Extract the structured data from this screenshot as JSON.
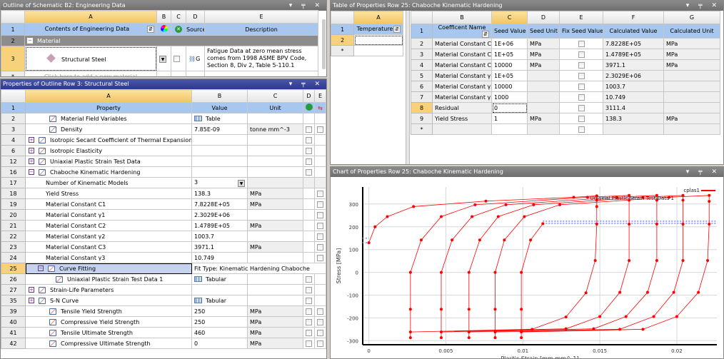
{
  "outline": {
    "title": "Outline of Schematic B2: Engineering Data",
    "columns": [
      "A",
      "B",
      "C",
      "D",
      "E"
    ],
    "header": {
      "contents": "Contents of Engineering Data",
      "source": "Source",
      "description": "Description"
    },
    "category": "Material",
    "material": {
      "name": "Structural Steel",
      "source": "G",
      "description": "Fatigue Data at zero mean stress comes from 1998 ASME BPV Code, Section 8, Div 2, Table 5-110.1"
    },
    "new_row_placeholder": "Click here to add a new material",
    "row_numbers": [
      "1",
      "2",
      "3",
      "*"
    ]
  },
  "properties": {
    "title": "Properties of Outline Row 3: Structural Steel",
    "columns": [
      "A",
      "B",
      "C",
      "D",
      "E"
    ],
    "header": {
      "property": "Property",
      "value": "Value",
      "unit": "Unit"
    },
    "rows": [
      {
        "n": "2",
        "level": 1,
        "exp": "",
        "icon": true,
        "name": "Material Field Variables",
        "value": "Table",
        "vicon": true,
        "unit": "",
        "d": false,
        "e": false
      },
      {
        "n": "3",
        "level": 1,
        "exp": "",
        "icon": true,
        "name": "Density",
        "value": "7.85E-09",
        "unit": "tonne mm^-3",
        "d": true,
        "e": true
      },
      {
        "n": "4",
        "level": 0,
        "exp": "+",
        "icon": true,
        "name": "Isotropic Secant Coefficient of Thermal Expansion",
        "value": "",
        "unit": "",
        "d": true,
        "e": false
      },
      {
        "n": "6",
        "level": 0,
        "exp": "+",
        "icon": true,
        "name": "Isotropic Elasticity",
        "value": "",
        "unit": "",
        "d": true,
        "e": false
      },
      {
        "n": "12",
        "level": 0,
        "exp": "+",
        "icon": true,
        "name": "Uniaxial Plastic Strain Test Data",
        "value": "",
        "unit": "",
        "d": true,
        "e": false
      },
      {
        "n": "16",
        "level": 0,
        "exp": "-",
        "icon": true,
        "name": "Chaboche Kinematic Hardening",
        "value": "",
        "unit": "",
        "d": true,
        "e": false
      },
      {
        "n": "17",
        "level": 2,
        "exp": "",
        "icon": false,
        "name": "Number of Kinematic Models",
        "value": "3",
        "dropdown": true,
        "unit": "",
        "d": false,
        "e": false
      },
      {
        "n": "18",
        "level": 2,
        "exp": "",
        "icon": false,
        "name": "Yield Stress",
        "value": "138.3",
        "unit": "MPa",
        "d": false,
        "e": true
      },
      {
        "n": "19",
        "level": 2,
        "exp": "",
        "icon": false,
        "name": "Material Constant C1",
        "value": "7.8228E+05",
        "unit": "MPa",
        "d": false,
        "e": true
      },
      {
        "n": "20",
        "level": 2,
        "exp": "",
        "icon": false,
        "name": "Material Constant γ1",
        "value": "2.3029E+06",
        "unit": "",
        "d": false,
        "e": true
      },
      {
        "n": "21",
        "level": 2,
        "exp": "",
        "icon": false,
        "name": "Material Constant C2",
        "value": "1.4789E+05",
        "unit": "MPa",
        "d": false,
        "e": true
      },
      {
        "n": "22",
        "level": 2,
        "exp": "",
        "icon": false,
        "name": "Material Constant γ2",
        "value": "1003.7",
        "unit": "",
        "d": false,
        "e": true
      },
      {
        "n": "23",
        "level": 2,
        "exp": "",
        "icon": false,
        "name": "Material Constant C3",
        "value": "3971.1",
        "unit": "MPa",
        "d": false,
        "e": true
      },
      {
        "n": "24",
        "level": 2,
        "exp": "",
        "icon": false,
        "name": "Material Constant γ3",
        "value": "10.749",
        "unit": "",
        "d": false,
        "e": true
      },
      {
        "n": "25",
        "level": 1,
        "exp": "-",
        "icon": true,
        "name": "Curve Fitting",
        "value": "Fit Type: Kinematic Hardening Chaboche",
        "span": true,
        "selected": true
      },
      {
        "n": "26",
        "level": 3,
        "exp": "",
        "icon": true,
        "name": "Uniaxial Plastic Strain Test Data 1",
        "value": "Tabular",
        "vicon": true,
        "unit": "",
        "d": true,
        "e": false
      },
      {
        "n": "27",
        "level": 0,
        "exp": "+",
        "icon": true,
        "name": "Strain-Life Parameters",
        "value": "",
        "unit": "",
        "d": true,
        "e": false
      },
      {
        "n": "35",
        "level": 0,
        "exp": "+",
        "icon": true,
        "name": "S-N Curve",
        "value": "Tabular",
        "vicon": true,
        "unit": "",
        "d": true,
        "e": false
      },
      {
        "n": "39",
        "level": 1,
        "exp": "",
        "icon": true,
        "name": "Tensile Yield Strength",
        "value": "250",
        "unit": "MPa",
        "d": true,
        "e": true
      },
      {
        "n": "40",
        "level": 1,
        "exp": "",
        "icon": true,
        "name": "Compressive Yield Strength",
        "value": "250",
        "unit": "MPa",
        "d": true,
        "e": true
      },
      {
        "n": "41",
        "level": 1,
        "exp": "",
        "icon": true,
        "name": "Tensile Ultimate Strength",
        "value": "460",
        "unit": "MPa",
        "d": true,
        "e": true
      },
      {
        "n": "42",
        "level": 1,
        "exp": "",
        "icon": true,
        "name": "Compressive Ultimate Strength",
        "value": "0",
        "unit": "MPa",
        "d": true,
        "e": true
      }
    ]
  },
  "table": {
    "title": "Table of Properties Row 25: Chaboche Kinematic Hardening",
    "temp": {
      "column": "A",
      "header": "Temperature",
      "rows": [
        "1",
        "2",
        "*"
      ]
    },
    "columns": [
      "B",
      "C",
      "D",
      "E",
      "F",
      "G"
    ],
    "headers": [
      "Coefficent Name",
      "Seed Value",
      "Seed Unit",
      "Fix Seed Value",
      "Calculated Value",
      "Calculated Unit"
    ],
    "rows": [
      {
        "n": "2",
        "name": "Material Constant C1",
        "seed": "1E+06",
        "seed_unit": "MPa",
        "calc": "7.8228E+05",
        "calc_unit": "MPa"
      },
      {
        "n": "3",
        "name": "Material Constant C2",
        "seed": "1E+05",
        "seed_unit": "MPa",
        "calc": "1.4789E+05",
        "calc_unit": "MPa"
      },
      {
        "n": "4",
        "name": "Material Constant C3",
        "seed": "10000",
        "seed_unit": "MPa",
        "calc": "3971.1",
        "calc_unit": "MPa"
      },
      {
        "n": "5",
        "name": "Material Constant γ1",
        "seed": "1E+05",
        "seed_unit": "",
        "calc": "2.3029E+06",
        "calc_unit": ""
      },
      {
        "n": "6",
        "name": "Material Constant γ2",
        "seed": "10000",
        "seed_unit": "",
        "calc": "1003.7",
        "calc_unit": ""
      },
      {
        "n": "7",
        "name": "Material Constant γ3",
        "seed": "1000",
        "seed_unit": "",
        "calc": "10.749",
        "calc_unit": ""
      },
      {
        "n": "8",
        "name": "Residual",
        "seed": "0",
        "seed_unit": "",
        "calc": "3111.4",
        "calc_unit": "",
        "selected": true
      },
      {
        "n": "9",
        "name": "Yield Stress",
        "seed": "1",
        "seed_unit": "MPa",
        "calc": "138.3",
        "calc_unit": "MPa"
      },
      {
        "n": "*",
        "name": "",
        "seed": "",
        "seed_unit": "",
        "calc": "",
        "calc_unit": ""
      }
    ]
  },
  "chart_panel_title": "Chart of Properties Row 25: Chaboche Kinematic Hardening",
  "chart_data": {
    "type": "line",
    "xlabel": "Plastic Strain  [mm mm^-1]",
    "ylabel": "Stress  [MPa]",
    "xlim": [
      -0.0004,
      0.0226
    ],
    "ylim": [
      -318,
      375
    ],
    "xticks": [
      "0",
      "0.005",
      "0.01",
      "0.015",
      "0.02"
    ],
    "yticks": [
      "300",
      "200",
      "100",
      "0",
      "-100",
      "-200",
      "-300"
    ],
    "grid": true,
    "legend": "top-right",
    "colors": {
      "fit": "#ff0000",
      "test": "#9aa6f0"
    },
    "series": [
      {
        "name": "cplas1",
        "points": [
          [
            0,
            130
          ],
          [
            0.0004,
            200
          ],
          [
            0.0012,
            245
          ],
          [
            0.0029,
            289
          ],
          [
            0.0076,
            313
          ],
          [
            0.0133,
            330
          ],
          [
            0.0148,
            336
          ],
          [
            0.0148,
            317
          ],
          [
            0.0148,
            289
          ],
          [
            0.0148,
            212
          ],
          [
            0.0147,
            52
          ],
          [
            0.0141,
            -90
          ],
          [
            0.0128,
            -196
          ],
          [
            0.0106,
            -250
          ],
          [
            0.0027,
            -262
          ],
          [
            0.0027,
            -287
          ],
          [
            0.0027,
            -162
          ],
          [
            0.0027,
            0
          ],
          [
            0.0034,
            142
          ],
          [
            0.0047,
            245
          ],
          [
            0.0069,
            297
          ],
          [
            0.0142,
            330
          ],
          [
            0.0169,
            338
          ],
          [
            0.0169,
            317
          ],
          [
            0.0169,
            212
          ],
          [
            0.0169,
            52
          ],
          [
            0.0163,
            -88
          ],
          [
            0.015,
            -194
          ],
          [
            0.0128,
            -248
          ],
          [
            0.0047,
            -262
          ],
          [
            0.0047,
            -287
          ],
          [
            0.0047,
            -162
          ],
          [
            0.0047,
            0
          ],
          [
            0.0054,
            142
          ],
          [
            0.0067,
            245
          ],
          [
            0.0089,
            297
          ],
          [
            0.0161,
            330
          ],
          [
            0.0187,
            338
          ],
          [
            0.0187,
            317
          ],
          [
            0.0187,
            212
          ],
          [
            0.0187,
            52
          ],
          [
            0.0181,
            -88
          ],
          [
            0.0167,
            -194
          ],
          [
            0.0146,
            -248
          ],
          [
            0.0065,
            -262
          ],
          [
            0.0065,
            -287
          ],
          [
            0.0065,
            -162
          ],
          [
            0.0065,
            0
          ],
          [
            0.0072,
            142
          ],
          [
            0.0084,
            245
          ],
          [
            0.0107,
            297
          ],
          [
            0.0178,
            330
          ],
          [
            0.0204,
            338
          ],
          [
            0.0204,
            317
          ],
          [
            0.0204,
            212
          ],
          [
            0.0204,
            52
          ],
          [
            0.0198,
            -88
          ],
          [
            0.0185,
            -194
          ],
          [
            0.0163,
            -250
          ],
          [
            0.0082,
            -262
          ],
          [
            0.0082,
            -287
          ],
          [
            0.0082,
            -162
          ],
          [
            0.0082,
            0
          ],
          [
            0.0088,
            142
          ],
          [
            0.0101,
            245
          ],
          [
            0.0124,
            297
          ],
          [
            0.0195,
            330
          ],
          [
            0.0221,
            338
          ],
          [
            0.0221,
            312
          ],
          [
            0.0221,
            212
          ],
          [
            0.022,
            52
          ],
          [
            0.0214,
            -88
          ],
          [
            0.02,
            -194
          ],
          [
            0.0178,
            -250
          ],
          [
            0.0099,
            -262
          ],
          [
            0.0099,
            -287
          ],
          [
            0.0099,
            -162
          ],
          [
            0.0099,
            0
          ],
          [
            0.0105,
            142
          ],
          [
            0.0113,
            214
          ]
        ]
      },
      {
        "name": "Uniaxial Plastic Strain Test Data 1",
        "segments": [
          [
            [
              -0.0004,
              150
            ],
            [
              0,
              150
            ]
          ],
          [
            [
              -0.0004,
              130
            ],
            [
              0,
              130
            ]
          ],
          [
            [
              0.0113,
              225
            ],
            [
              0.0226,
              225
            ]
          ],
          [
            [
              0.0113,
              215
            ],
            [
              0.0226,
              215
            ]
          ]
        ]
      }
    ]
  }
}
